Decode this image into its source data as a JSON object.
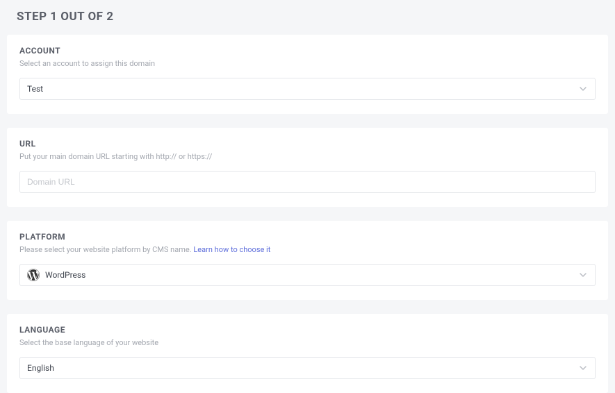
{
  "header": {
    "step": "STEP 1 OUT OF 2"
  },
  "account": {
    "title": "ACCOUNT",
    "desc": "Select an account to assign this domain",
    "selected": "Test"
  },
  "url": {
    "title": "URL",
    "desc": "Put your main domain URL starting with http:// or https://",
    "placeholder": "Domain URL",
    "value": ""
  },
  "platform": {
    "title": "PLATFORM",
    "desc": "Please select your website platform by CMS name.  ",
    "learn_link": "Learn how to choose it",
    "selected": "WordPress"
  },
  "language": {
    "title": "LANGUAGE",
    "desc": "Select the base language of your website",
    "selected": "English"
  }
}
